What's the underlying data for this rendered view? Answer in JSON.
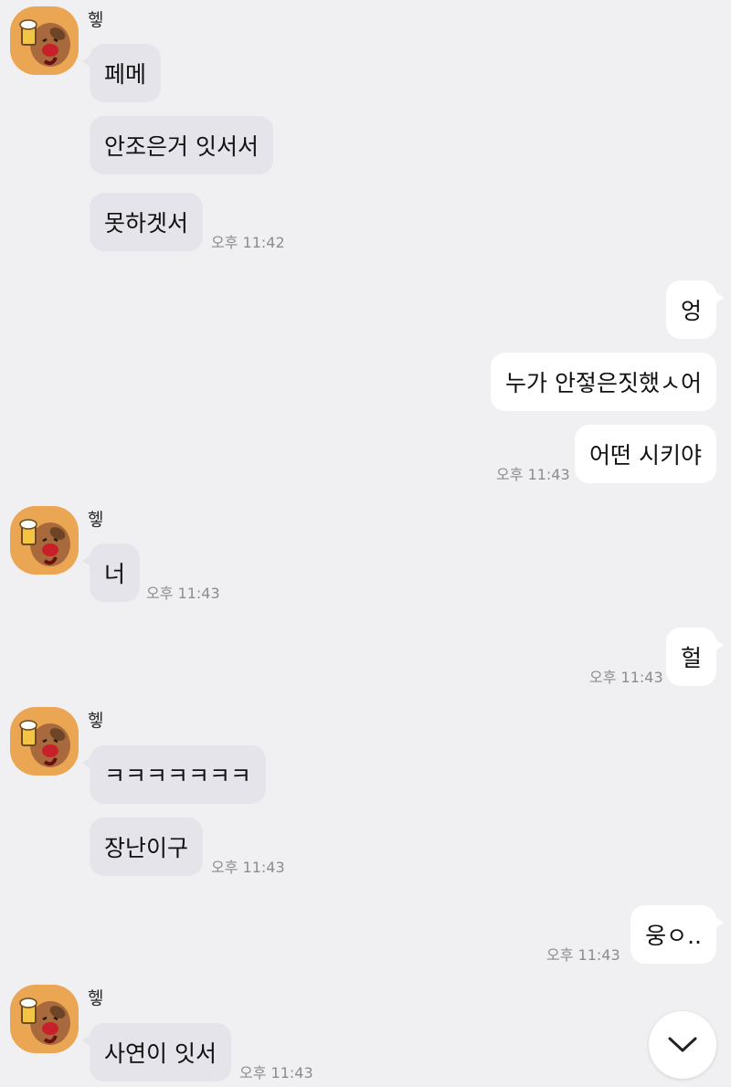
{
  "sender_name": "헿",
  "colors": {
    "background": "#f0f0f2",
    "incoming_bubble": "#e4e4ea",
    "outgoing_bubble": "#ffffff",
    "avatar_bg": "#eba653",
    "timestamp": "#8c8c8c"
  },
  "avatar_icon": "beer-dog-character-icon",
  "messages": [
    {
      "dir": "in",
      "text": "페메"
    },
    {
      "dir": "in",
      "text": "안조은거 잇서서"
    },
    {
      "dir": "in",
      "text": "못하겟서",
      "time": "오후 11:42"
    },
    {
      "dir": "out",
      "text": "엉"
    },
    {
      "dir": "out",
      "text": "누가 안젛은짓했ㅅ어"
    },
    {
      "dir": "out",
      "text": "어떤 시키야",
      "time": "오후 11:43"
    },
    {
      "dir": "in",
      "text": "너",
      "time": "오후 11:43"
    },
    {
      "dir": "out",
      "text": "헐",
      "time": "오후 11:43"
    },
    {
      "dir": "in",
      "text": "ㅋㅋㅋㅋㅋㅋㅋ"
    },
    {
      "dir": "in",
      "text": "장난이구",
      "time": "오후 11:43"
    },
    {
      "dir": "out",
      "text": "웅ㅇ..",
      "time": "오후 11:43"
    },
    {
      "dir": "in",
      "text": "사연이 잇서",
      "time": "오후 11:43"
    }
  ],
  "scroll_button_icon": "chevron-down-icon"
}
